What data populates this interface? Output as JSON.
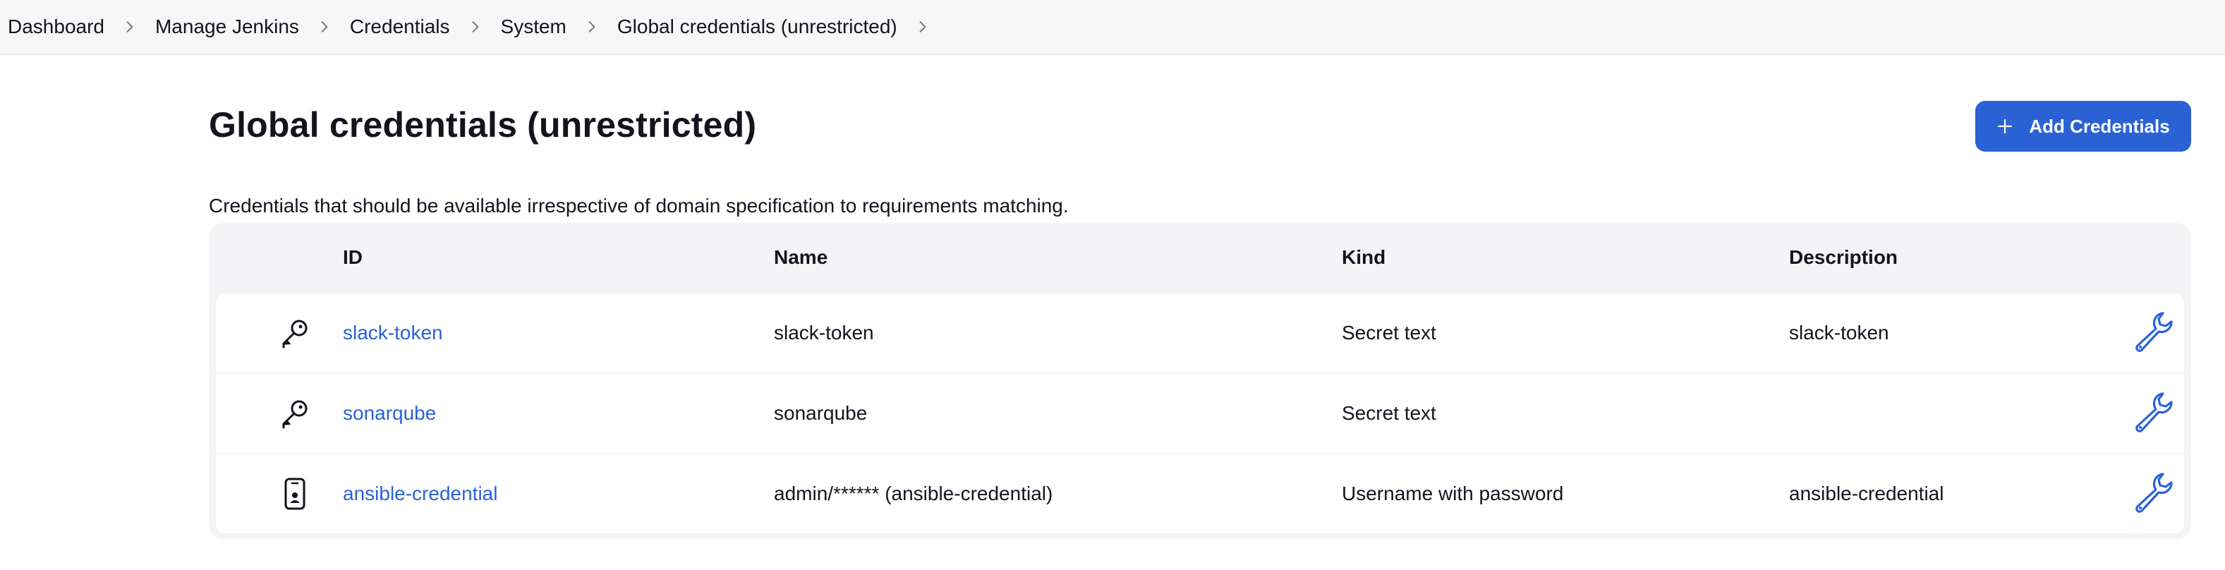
{
  "breadcrumbs": [
    "Dashboard",
    "Manage Jenkins",
    "Credentials",
    "System",
    "Global credentials (unrestricted)"
  ],
  "page": {
    "title": "Global credentials (unrestricted)",
    "description": "Credentials that should be available irrespective of domain specification to requirements matching.",
    "add_button_label": "Add Credentials"
  },
  "table": {
    "headers": {
      "id": "ID",
      "name": "Name",
      "kind": "Kind",
      "description": "Description"
    },
    "rows": [
      {
        "icon": "key-icon",
        "id": "slack-token",
        "name": "slack-token",
        "kind": "Secret text",
        "description": "slack-token"
      },
      {
        "icon": "key-icon",
        "id": "sonarqube",
        "name": "sonarqube",
        "kind": "Secret text",
        "description": ""
      },
      {
        "icon": "id-badge-icon",
        "id": "ansible-credential",
        "name": "admin/****** (ansible-credential)",
        "kind": "Username with password",
        "description": "ansible-credential"
      }
    ]
  },
  "colors": {
    "accent": "#2a62d6",
    "header_bg": "#f7f7f8",
    "table_bg": "#f4f4f6",
    "text": "#14141f"
  }
}
